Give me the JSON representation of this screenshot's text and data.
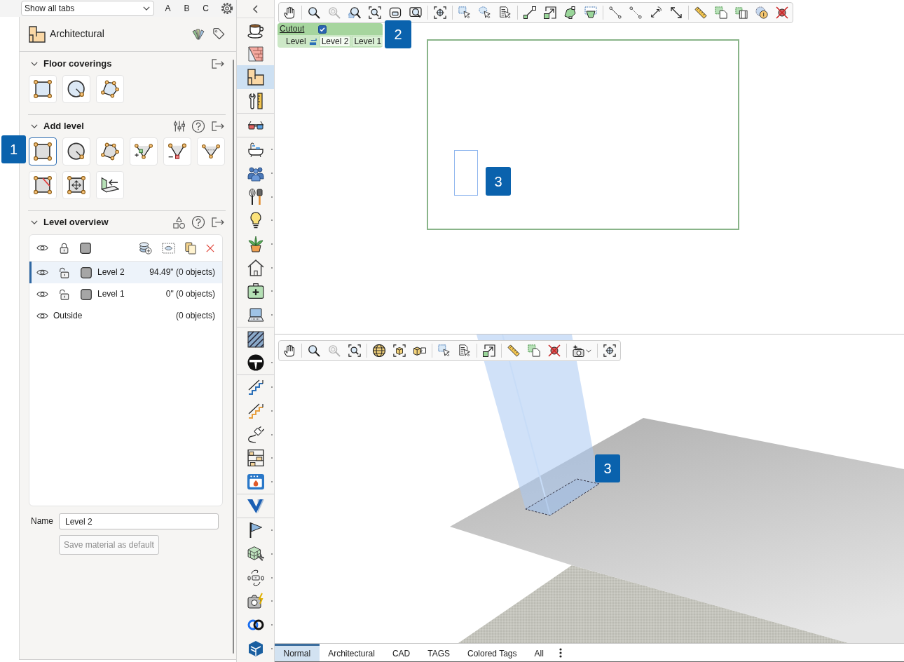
{
  "top_bar": {
    "tab_filter": {
      "value": "Show all tabs"
    },
    "letter_buttons": [
      "A",
      "B",
      "C"
    ]
  },
  "panel": {
    "title": "Architectural",
    "floor_coverings": {
      "title": "Floor coverings",
      "expanded": true,
      "tools": [
        {
          "selected": false
        },
        {
          "selected": false
        },
        {
          "selected": false
        }
      ]
    },
    "add_level": {
      "title": "Add level",
      "expanded": true,
      "callout": "1",
      "tools": [
        {
          "selected": true
        },
        {
          "selected": false
        },
        {
          "selected": false
        },
        {
          "selected": false
        },
        {
          "selected": false
        },
        {
          "selected": false
        },
        {
          "selected": false
        },
        {
          "selected": false
        },
        {
          "selected": false
        }
      ]
    },
    "level_overview": {
      "title": "Level overview",
      "expanded": true,
      "levels": [
        {
          "kind": "level",
          "name": "Level 2",
          "info": "94.49\" (0 objects)",
          "selected": true,
          "locked": false
        },
        {
          "kind": "level",
          "name": "Level 1",
          "info": "0\" (0 objects)",
          "selected": false,
          "locked": false
        },
        {
          "kind": "outside",
          "name": "Outside",
          "info": "(0 objects)",
          "selected": false
        }
      ]
    },
    "name_field": {
      "label": "Name",
      "value": "Level 2"
    },
    "save_button": {
      "label": "Save material as default",
      "disabled": true
    }
  },
  "icon_bar": {
    "groups": [
      {
        "items": [
          {
            "selected": false,
            "has_menu": false
          },
          {
            "selected": false,
            "has_menu": false
          },
          {
            "selected": true,
            "has_menu": false
          },
          {
            "selected": false,
            "has_menu": false
          }
        ]
      },
      {
        "items": [
          {
            "selected": false,
            "has_menu": false
          }
        ]
      },
      {
        "items": [
          {
            "selected": false,
            "has_menu": true
          },
          {
            "selected": false,
            "has_menu": true
          },
          {
            "selected": false,
            "has_menu": true
          },
          {
            "selected": false,
            "has_menu": true
          },
          {
            "selected": false,
            "has_menu": true
          },
          {
            "selected": false,
            "has_menu": true
          },
          {
            "selected": false,
            "has_menu": true
          },
          {
            "selected": false,
            "has_menu": true
          }
        ]
      },
      {
        "items": [
          {
            "selected": false,
            "has_menu": false
          },
          {
            "selected": false,
            "has_menu": true
          }
        ]
      },
      {
        "items": [
          {
            "selected": false,
            "has_menu": true
          },
          {
            "selected": false,
            "has_menu": true
          },
          {
            "selected": false,
            "has_menu": true
          },
          {
            "selected": false,
            "has_menu": true
          },
          {
            "selected": false,
            "has_menu": true
          }
        ]
      },
      {
        "items": [
          {
            "selected": false,
            "has_menu": false
          }
        ]
      },
      {
        "items": [
          {
            "selected": false,
            "has_menu": true
          },
          {
            "selected": false,
            "has_menu": true
          },
          {
            "selected": false,
            "has_menu": true
          },
          {
            "selected": false,
            "has_menu": true
          },
          {
            "selected": false,
            "has_menu": true
          },
          {
            "selected": false,
            "has_menu": true
          }
        ]
      }
    ]
  },
  "plan_view": {
    "toolbar": [
      {
        "disabled": false
      },
      {
        "disabled": false
      },
      {
        "disabled": true
      },
      {
        "disabled": false
      },
      {
        "disabled": false
      },
      {
        "disabled": false
      },
      {
        "disabled": false
      },
      {
        "disabled": false
      },
      {
        "disabled": false
      },
      {
        "disabled": false
      },
      {
        "disabled": false
      },
      {
        "disabled": false
      },
      {
        "disabled": false
      },
      {
        "disabled": false
      },
      {
        "disabled": false
      },
      {
        "disabled": false
      },
      {
        "disabled": false
      },
      {
        "disabled": false
      },
      {
        "disabled": false
      },
      {
        "disabled": false
      },
      {
        "disabled": false
      },
      {
        "disabled": false
      },
      {
        "disabled": false
      },
      {
        "disabled": false
      }
    ],
    "cutout_tag": {
      "label": "Cutout",
      "checked": true,
      "level_label": "Level",
      "levels": [
        {
          "label": "Level 2",
          "selected": true
        },
        {
          "label": "Level 1",
          "selected": false
        }
      ]
    },
    "callouts": [
      "2",
      "3"
    ]
  },
  "view_3d": {
    "toolbar": [
      {
        "disabled": false
      },
      {
        "disabled": false
      },
      {
        "disabled": true
      },
      {
        "disabled": false
      },
      {
        "disabled": false
      },
      {
        "disabled": false
      },
      {
        "disabled": false
      },
      {
        "disabled": false
      },
      {
        "disabled": false
      },
      {
        "disabled": false
      },
      {
        "disabled": false
      },
      {
        "disabled": false
      },
      {
        "disabled": false
      },
      {
        "disabled": false
      },
      {
        "disabled": false
      }
    ],
    "callout": "3"
  },
  "bottom_tabs": [
    {
      "label": "Normal",
      "selected": true
    },
    {
      "label": "Architectural",
      "selected": false
    },
    {
      "label": "CAD",
      "selected": false
    },
    {
      "label": "TAGS",
      "selected": false
    },
    {
      "label": "Colored Tags",
      "selected": false
    },
    {
      "label": "All",
      "selected": false
    }
  ]
}
